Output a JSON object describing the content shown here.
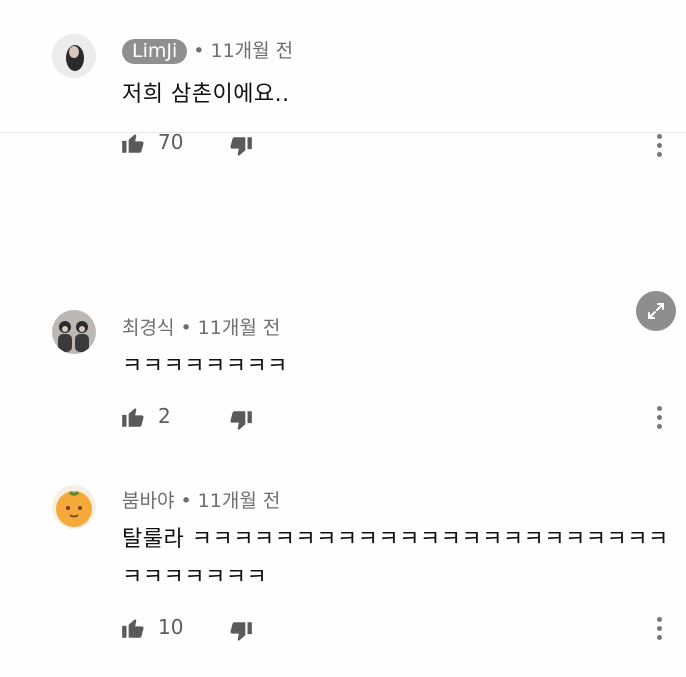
{
  "comments": [
    {
      "author": "LimJi",
      "time": "11개월 전",
      "text_lines": [
        "저희 삼촌이에요.."
      ],
      "likes": "70",
      "author_highlighted": true
    },
    {
      "author": "최경식",
      "time": "11개월 전",
      "text_lines": [
        "ㅋㅋㅋㅋㅋㅋㅋㅋ"
      ],
      "likes": "2",
      "author_highlighted": false
    },
    {
      "author": "붐바야",
      "time": "11개월 전",
      "text_lines": [
        "탈룰라 ㅋㅋㅋㅋㅋㅋㅋㅋㅋㅋㅋㅋㅋㅋㅋㅋㅋㅋㅋㅋㅋㅋㅋ",
        "ㅋㅋㅋㅋㅋㅋㅋ"
      ],
      "likes": "10",
      "author_highlighted": false
    }
  ],
  "meta_separator": "•",
  "icons": {
    "like": "thumbs-up-icon",
    "dislike": "thumbs-down-icon",
    "more": "more-vertical-icon",
    "expand": "expand-icon"
  },
  "colors": {
    "author_pill": "#8f8f8f",
    "meta_text": "#6e6e6e",
    "icon": "#5a5a5a"
  }
}
